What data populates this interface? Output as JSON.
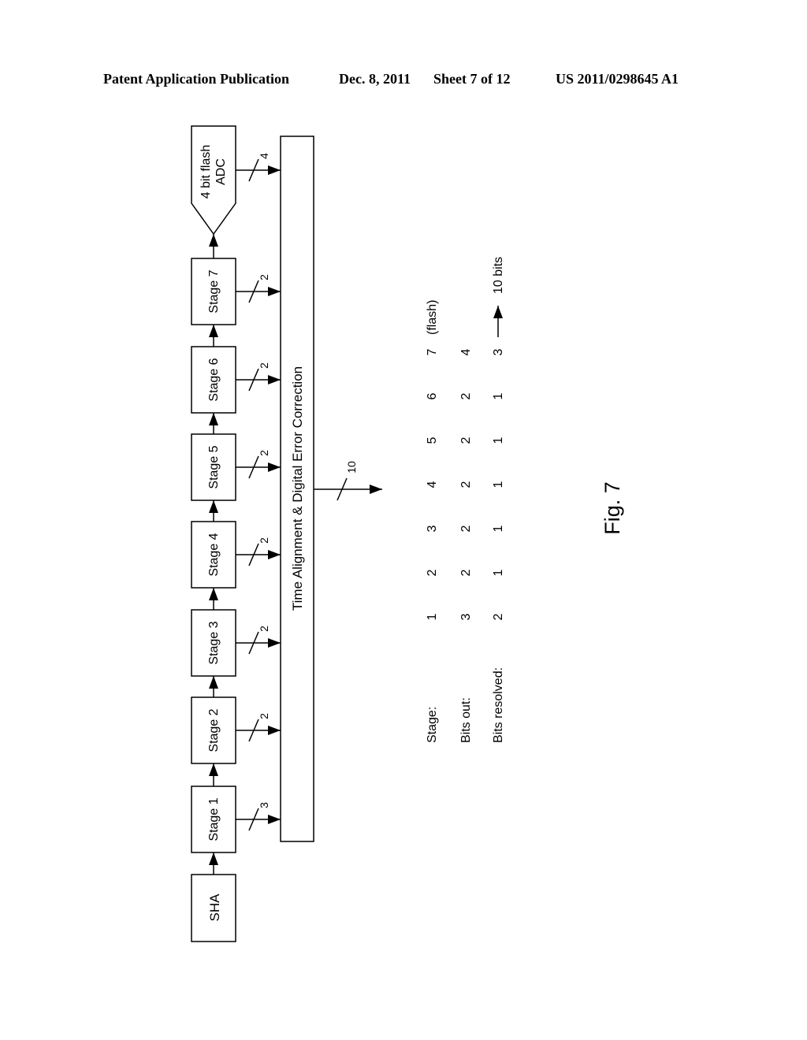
{
  "header": {
    "publication": "Patent Application Publication",
    "date": "Dec. 8, 2011",
    "sheet": "Sheet 7 of 12",
    "number": "US 2011/0298645 A1"
  },
  "diagram": {
    "sha_label": "SHA",
    "stages": [
      {
        "label": "Stage 1",
        "bits": "3"
      },
      {
        "label": "Stage 2",
        "bits": "2"
      },
      {
        "label": "Stage 3",
        "bits": "2"
      },
      {
        "label": "Stage 4",
        "bits": "2"
      },
      {
        "label": "Stage 5",
        "bits": "2"
      },
      {
        "label": "Stage 6",
        "bits": "2"
      },
      {
        "label": "Stage 7",
        "bits": "2"
      }
    ],
    "flash_adc": {
      "line1": "4 bit flash",
      "line2": "ADC",
      "bits": "4"
    },
    "bus_label": "Time Alignment & Digital Error Correction",
    "output_bits": "10"
  },
  "table": {
    "rows": [
      {
        "label": "Stage:",
        "values": [
          "1",
          "2",
          "3",
          "4",
          "5",
          "6",
          "7"
        ],
        "suffix": "(flash)"
      },
      {
        "label": "Bits out:",
        "values": [
          "3",
          "2",
          "2",
          "2",
          "2",
          "2",
          "4"
        ],
        "suffix": ""
      },
      {
        "label": "Bits resolved:",
        "values": [
          "2",
          "1",
          "1",
          "1",
          "1",
          "1",
          "3"
        ],
        "suffix": ""
      }
    ],
    "total": "10 bits"
  },
  "figure_label": "Fig. 7"
}
